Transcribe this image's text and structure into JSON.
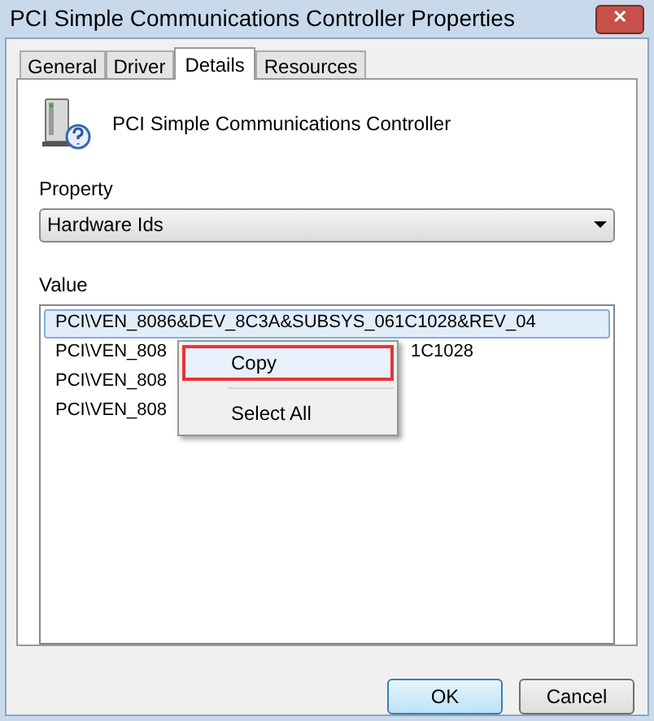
{
  "window": {
    "title": "PCI Simple Communications Controller Properties",
    "close": "✕"
  },
  "tabs": [
    {
      "label": "General",
      "selected": false
    },
    {
      "label": "Driver",
      "selected": false
    },
    {
      "label": "Details",
      "selected": true
    },
    {
      "label": "Resources",
      "selected": false
    }
  ],
  "device_name": "PCI Simple Communications Controller",
  "property": {
    "label": "Property",
    "value": "Hardware Ids"
  },
  "value": {
    "label": "Value",
    "rows": [
      {
        "text": "PCI\\VEN_8086&DEV_8C3A&SUBSYS_061C1028&REV_04",
        "selected": true
      },
      {
        "text": "PCI\\VEN_808",
        "text_after": "1C1028",
        "selected": false
      },
      {
        "text": "PCI\\VEN_808",
        "selected": false
      },
      {
        "text": "PCI\\VEN_808",
        "selected": false
      }
    ]
  },
  "context_menu": [
    {
      "label": "Copy",
      "selected": true
    },
    {
      "label": "Select All",
      "selected": false
    }
  ],
  "buttons": [
    {
      "label": "OK",
      "default": true
    },
    {
      "label": "Cancel",
      "default": false
    }
  ]
}
